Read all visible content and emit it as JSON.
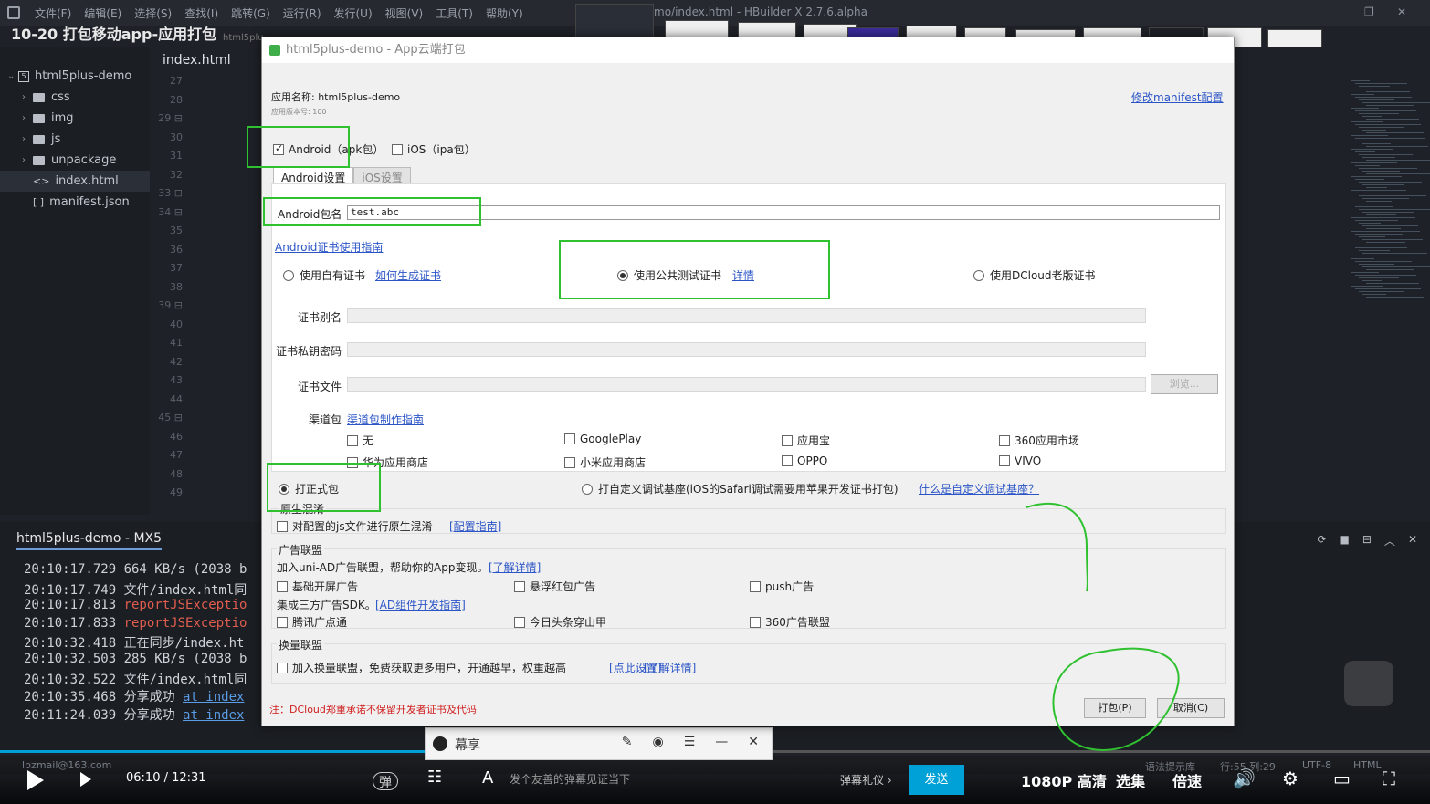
{
  "ide": {
    "menu": [
      "文件(F)",
      "编辑(E)",
      "选择(S)",
      "查找(I)",
      "跳转(G)",
      "运行(R)",
      "发行(U)",
      "视图(V)",
      "工具(T)",
      "帮助(Y)"
    ],
    "window_title": "mo/index.html - HBuilder X 2.7.6.alpha",
    "video_title": "10-20 打包移动app-应用打包",
    "tab_small": "html5plu",
    "editor_tab": "index.html",
    "line_numbers": [
      "27",
      "28",
      "29 ⊟",
      "30",
      "31",
      "32",
      "33 ⊟",
      "34 ⊟",
      "35",
      "36",
      "37",
      "38",
      "39 ⊟",
      "40",
      "41",
      "42",
      "43",
      "44",
      "45 ⊟",
      "46",
      "47",
      "48",
      "49"
    ],
    "project": {
      "root": "html5plus-demo",
      "items": [
        {
          "label": "css",
          "type": "folder"
        },
        {
          "label": "img",
          "type": "folder"
        },
        {
          "label": "js",
          "type": "folder"
        },
        {
          "label": "unpackage",
          "type": "folder"
        },
        {
          "label": "index.html",
          "type": "file",
          "icon": "<>"
        },
        {
          "label": "manifest.json",
          "type": "file",
          "icon": "[ ]"
        }
      ]
    }
  },
  "console": {
    "title": "html5plus-demo - MX5",
    "lines": [
      {
        "time": "20:10:17.729",
        "text": "664 KB/s (2038 b",
        "cls": ""
      },
      {
        "time": "20:10:17.749",
        "text": "文件/index.html同",
        "cls": ""
      },
      {
        "time": "20:10:17.813",
        "text": "reportJSExceptio",
        "cls": "err"
      },
      {
        "time": "20:10:17.833",
        "text": "reportJSExceptio",
        "cls": "err"
      },
      {
        "time": "20:10:32.418",
        "text": "正在同步/index.ht",
        "cls": ""
      },
      {
        "time": "20:10:32.503",
        "text": "285 KB/s (2038 b",
        "cls": ""
      },
      {
        "time": "20:10:32.522",
        "text": "文件/index.html同",
        "cls": ""
      },
      {
        "time": "20:10:35.468",
        "text": "分享成功 ",
        "link": "at index",
        "cls": ""
      },
      {
        "time": "20:11:24.039",
        "text": "分享成功 ",
        "link": "at index",
        "cls": ""
      }
    ]
  },
  "status": {
    "email": "lpzmail@163.com",
    "syntax": "语法提示库",
    "position": "行:55  列:29",
    "encoding": "UTF-8",
    "lang": "HTML"
  },
  "player": {
    "time": "06:10 / 12:31",
    "danmu_placeholder": "发个友善的弹幕见证当下",
    "gift": "弹幕礼仪 ›",
    "send": "发送",
    "quality": "1080P 高清",
    "select": "选集",
    "speed": "倍速",
    "share_app": "幕享",
    "progress": 0.493
  },
  "dialog": {
    "title": "html5plus-demo - App云端打包",
    "app_name": "应用名称: html5plus-demo",
    "app_version": "应用版本号: 100",
    "modify_manifest": "修改manifest配置",
    "android_check": "Android（apk包）",
    "ios_check": "iOS（ipa包）",
    "tab_android": "Android设置",
    "tab_ios": "iOS设置",
    "pkg_label": "Android包名",
    "pkg_value": "test.abc",
    "cert_guide": "Android证书使用指南",
    "cert_own": "使用自有证书",
    "cert_own_link": "如何生成证书",
    "cert_public": "使用公共测试证书",
    "cert_public_link": "详情",
    "cert_dcloud": "使用DCloud老版证书",
    "alias_label": "证书别名",
    "key_label": "证书私钥密码",
    "file_label": "证书文件",
    "browse": "浏览...",
    "channel_label": "渠道包",
    "channel_link": "渠道包制作指南",
    "channels": [
      "无",
      "GooglePlay",
      "应用宝",
      "360应用市场",
      "华为应用商店",
      "小米应用商店",
      "OPPO",
      "VIVO"
    ],
    "formal_pkg": "打正式包",
    "custom_base": "打自定义调试基座(iOS的Safari调试需要用苹果开发证书打包)",
    "custom_base_link": "什么是自定义调试基座？",
    "obfuscation_title": "原生混淆",
    "obfuscation_check": "对配置的js文件进行原生混淆",
    "obfuscation_link": "[配置指南]",
    "ad_title": "广告联盟",
    "ad_desc": "加入uni-AD广告联盟，帮助你的App变现。",
    "ad_link": "[了解详情]",
    "ad_items1": [
      "基础开屏广告",
      "悬浮红包广告",
      "push广告"
    ],
    "ad_sdk": "集成三方广告SDK。",
    "ad_sdk_link": "[AD组件开发指南]",
    "ad_items2": [
      "腾讯广点通",
      "今日头条穿山甲",
      "360广告联盟"
    ],
    "exchange_title": "换量联盟",
    "exchange_check": "加入换量联盟，免费获取更多用户，开通越早，权重越高",
    "exchange_link1": "[点此设置]",
    "exchange_link2": "[了解详情]",
    "notice": "注：DCloud郑重承诺不保留开发者证书及代码",
    "pack_btn": "打包(P)",
    "cancel_btn": "取消(C)"
  },
  "colors": {
    "accent": "#2fc12f",
    "link": "#2b55c7",
    "send": "#00a1d6"
  }
}
